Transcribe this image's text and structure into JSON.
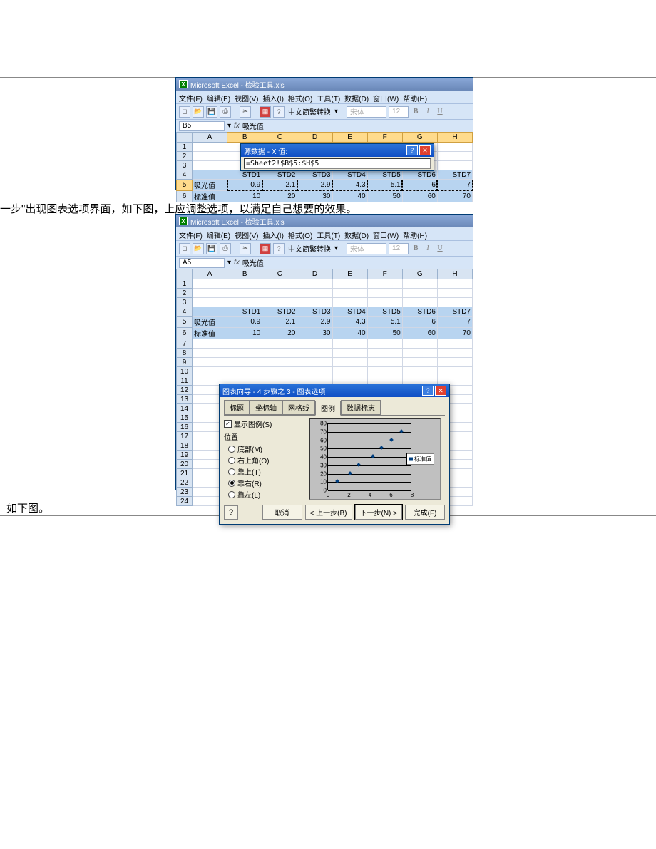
{
  "doc": {
    "text1": "一步\"出现图表选项界面，如下图，上应调整选项，以满足自己想要的效果。",
    "text2": "如下图。"
  },
  "excel": {
    "title": "Microsoft Excel - 检验工具.xls",
    "menus": {
      "file": "文件(F)",
      "edit": "编辑(E)",
      "view": "视图(V)",
      "insert": "插入(I)",
      "format": "格式(O)",
      "tools": "工具(T)",
      "data": "数据(D)",
      "window": "窗口(W)",
      "help": "帮助(H)"
    },
    "toolbar": {
      "convert": "中文简繁转换",
      "font": "宋体",
      "size": "12",
      "bold": "B",
      "italic": "I",
      "underline": "U"
    },
    "s1": {
      "name": "B5",
      "fx": "fx",
      "cellval": "吸光值"
    },
    "s2": {
      "name": "A5",
      "cellval": "吸光值"
    },
    "columns": [
      "A",
      "B",
      "C",
      "D",
      "E",
      "F",
      "G",
      "H"
    ],
    "stdHeaders": [
      "",
      "STD1",
      "STD2",
      "STD3",
      "STD4",
      "STD5",
      "STD6",
      "STD7"
    ],
    "row5_label": "吸光值",
    "row5_values": [
      "0.9",
      "2.1",
      "2.9",
      "4.3",
      "5.1",
      "6",
      "7"
    ],
    "row6_label": "标准值",
    "row6_values": [
      "10",
      "20",
      "30",
      "40",
      "50",
      "60",
      "70"
    ]
  },
  "srcDialog": {
    "title": "源数据 - X 值:",
    "ref": "=Sheet2!$B$5:$H$5"
  },
  "wizard": {
    "title": "图表向导 - 4 步骤之 3 - 图表选项",
    "tabs": {
      "t1": "标题",
      "t2": "坐标轴",
      "t3": "网格线",
      "t4": "图例",
      "t5": "数据标志"
    },
    "showLegend": "显示图例(S)",
    "positionLabel": "位置",
    "positions": {
      "bottom": "底部(M)",
      "topright": "右上角(O)",
      "top": "靠上(T)",
      "right": "靠右(R)",
      "left": "靠左(L)"
    },
    "legendText": "标准值",
    "buttons": {
      "cancel": "取消",
      "back": "< 上一步(B)",
      "next": "下一步(N) >",
      "finish": "完成(F)"
    }
  },
  "chart_data": {
    "type": "scatter",
    "x": [
      0.9,
      2.1,
      2.9,
      4.3,
      5.1,
      6,
      7
    ],
    "y": [
      10,
      20,
      30,
      40,
      50,
      60,
      70
    ],
    "series_name": "标准值",
    "xlim": [
      0,
      8
    ],
    "ylim": [
      0,
      80
    ],
    "xticks": [
      0,
      2,
      4,
      6,
      8
    ],
    "yticks": [
      0,
      10,
      20,
      30,
      40,
      50,
      60,
      70,
      80
    ]
  }
}
